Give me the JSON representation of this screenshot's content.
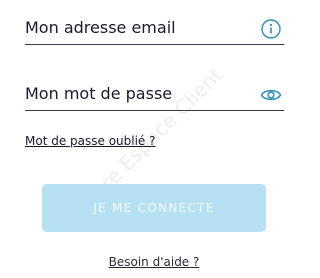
{
  "form": {
    "email_label": "Mon adresse email",
    "password_label": "Mon mot de passe",
    "forgot_link": "Mot de passe oublié ?",
    "submit_label": "JE ME CONNECTE",
    "help_link": "Besoin d'aide ?"
  },
  "icons": {
    "email_info": "info-icon",
    "password_toggle": "eye-icon"
  },
  "watermark": "Votre Espace Client",
  "colors": {
    "accent": "#2a8fbf",
    "button_disabled": "#b5e1f3",
    "button_text": "#f4fbfe",
    "text": "#1a1a2e"
  }
}
